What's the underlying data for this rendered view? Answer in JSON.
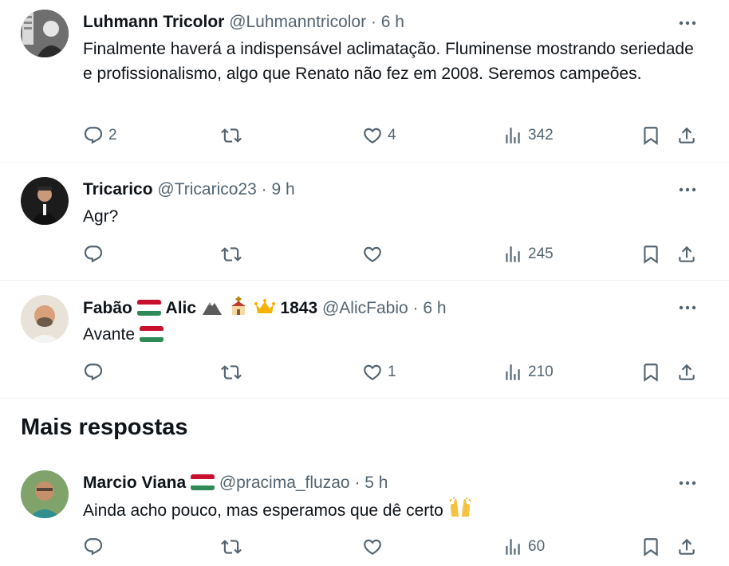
{
  "replies": [
    {
      "name": "Luhmann Tricolor",
      "handle": "@Luhmanntricolor",
      "sep": "·",
      "time": "6 h",
      "text": "Finalmente haverá a indispensável aclimatação. Fluminense mostrando seriedade e profissionalismo, algo que Renato não fez em 2008. Seremos campeões.",
      "replies_count": "2",
      "retweets_count": "",
      "likes_count": "4",
      "views_count": "342"
    },
    {
      "name": "Tricarico",
      "handle": "@Tricarico23",
      "sep": "·",
      "time": "9 h",
      "text": "Agr?",
      "replies_count": "",
      "retweets_count": "",
      "likes_count": "",
      "views_count": "245"
    },
    {
      "name_part1": "Fabão",
      "name_part2": "Alic",
      "name_part3": "1843",
      "handle": "@AlicFabio",
      "sep": "·",
      "time": "6 h",
      "text": "Avante",
      "replies_count": "",
      "retweets_count": "",
      "likes_count": "1",
      "views_count": "210"
    },
    {
      "name": "Marcio Viana",
      "handle": "@pracima_fluzao",
      "sep": "·",
      "time": "5 h",
      "text": "Ainda acho pouco, mas esperamos que dê certo",
      "replies_count": "",
      "retweets_count": "",
      "likes_count": "",
      "views_count": "60"
    }
  ],
  "section_title": "Mais respostas",
  "icons": {
    "more": "more-icon",
    "reply": "reply-icon",
    "retweet": "retweet-icon",
    "like": "heart-icon",
    "views": "views-icon",
    "bookmark": "bookmark-icon",
    "share": "share-icon"
  },
  "colors": {
    "text": "#0f1419",
    "secondary": "#536471",
    "border": "#eff3f4",
    "flag_red": "#c8102e",
    "flag_white": "#ffffff",
    "flag_green": "#2e8b57"
  }
}
